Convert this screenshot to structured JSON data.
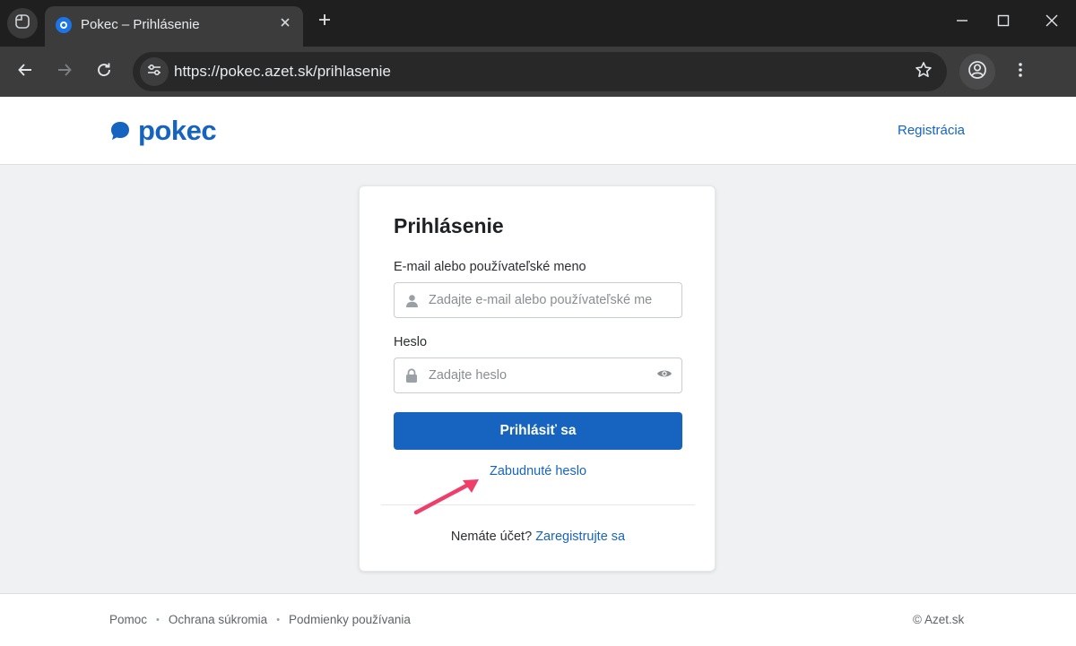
{
  "browser": {
    "tab_title": "Pokec – Prihlásenie",
    "url": "https://pokec.azet.sk/prihlasenie",
    "icons": [
      "tab-actions-icon",
      "favicon",
      "close-icon",
      "plus-icon",
      "minimize-icon",
      "maximize-icon",
      "window-close-icon",
      "back-arrow-icon",
      "forward-arrow-icon",
      "reload-icon",
      "site-settings-icon",
      "star-icon",
      "profile-icon",
      "kebab-menu-icon"
    ]
  },
  "header": {
    "logo_text": "pokec",
    "register_link": "Registrácia"
  },
  "login": {
    "title": "Prihlásenie",
    "username_label": "E-mail alebo používateľské meno",
    "username_placeholder": "Zadajte e-mail alebo používateľské meno",
    "username_value": "",
    "password_label": "Heslo",
    "password_placeholder": "Zadajte heslo",
    "password_value": "",
    "submit_label": "Prihlásiť sa",
    "forgot_password": "Zabudnuté heslo",
    "no_account_text": "Nemáte účet?",
    "register_link": "Zaregistrujte sa"
  },
  "footer": {
    "links": [
      "Pomoc",
      "Ochrana súkromia",
      "Podmienky používania"
    ],
    "separator": "•",
    "copyright": "© Azet.sk"
  },
  "colors": {
    "brand": "#1664c0",
    "annotation_arrow": "#ee3f6b",
    "page_background": "#f0f1f3"
  }
}
